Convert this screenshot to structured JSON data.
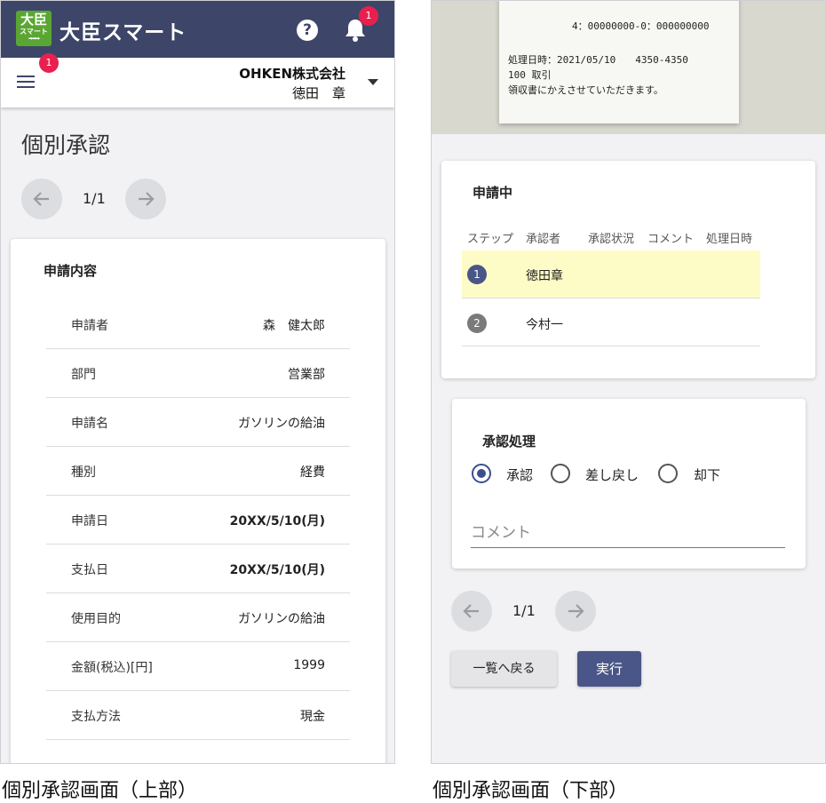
{
  "top_screen": {
    "app": {
      "logo_line1": "大臣",
      "logo_line2": "スマート",
      "title": "大臣スマート",
      "notification_count": "1",
      "menu_badge": "1"
    },
    "account": {
      "company": "OHKEN株式会社",
      "user": "徳田　章"
    },
    "page_title": "個別承認",
    "pager": "1/1",
    "detail_card": {
      "title": "申請内容",
      "rows": [
        {
          "label": "申請者",
          "value": "森　健太郎"
        },
        {
          "label": "部門",
          "value": "営業部"
        },
        {
          "label": "申請名",
          "value": "ガソリンの給油"
        },
        {
          "label": "種別",
          "value": "経費"
        },
        {
          "label": "申請日",
          "value": "20XX/5/10(月)"
        },
        {
          "label": "支払日",
          "value": "20XX/5/10(月)"
        },
        {
          "label": "使用目的",
          "value": "ガソリンの給油"
        },
        {
          "label": "金額(税込)[円]",
          "value": "1999"
        },
        {
          "label": "支払方法",
          "value": "現金"
        }
      ]
    }
  },
  "bottom_screen": {
    "receipt": {
      "line1": "4：00000000-0：000000000",
      "line2": "処理日時：2021/05/10　　4350-4350",
      "line3": "100 取引",
      "line4": "領収書にかえさせていただきます。"
    },
    "status_card": {
      "title": "申請中",
      "columns": [
        "ステップ",
        "承認者",
        "承認状況",
        "コメント",
        "処理日時"
      ],
      "rows": [
        {
          "step": "1",
          "approver": "徳田章"
        },
        {
          "step": "2",
          "approver": "今村一"
        }
      ]
    },
    "approve_card": {
      "title": "承認処理",
      "options": [
        "承認",
        "差し戻し",
        "却下"
      ],
      "selected": "承認",
      "comment_placeholder": "コメント"
    },
    "pager": "1/1",
    "back_button": "一覧へ戻る",
    "execute_button": "実行"
  },
  "captions": {
    "top": "個別承認画面（上部）",
    "bottom": "個別承認画面（下部）"
  },
  "colors": {
    "header": "#3d4668",
    "logo_green": "#5aa632",
    "badge": "#e8204f",
    "highlight_row": "#fdfcc6",
    "primary_button": "#4a5687"
  }
}
